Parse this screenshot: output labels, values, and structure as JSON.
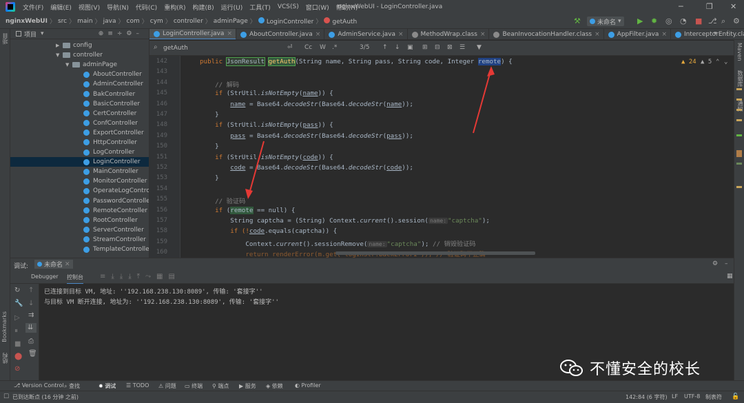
{
  "menu": {
    "items": [
      "文件(F)",
      "编辑(E)",
      "视图(V)",
      "导航(N)",
      "代码(C)",
      "重构(R)",
      "构建(B)",
      "运行(U)",
      "工具(T)",
      "VCS(S)",
      "窗口(W)",
      "帮助(H)"
    ],
    "window_title": "nginxWebUI - LoginController.java"
  },
  "breadcrumb": [
    "nginxWebUI",
    "src",
    "main",
    "java",
    "com",
    "cym",
    "controller",
    "adminPage",
    "LoginController",
    "getAuth"
  ],
  "toolbar": {
    "run_config": "未命名"
  },
  "project": {
    "header": "项目",
    "tree": [
      {
        "label": "config",
        "type": "folder",
        "indent": 1,
        "expanded": false
      },
      {
        "label": "controller",
        "type": "folder",
        "indent": 1,
        "expanded": true
      },
      {
        "label": "adminPage",
        "type": "folder",
        "indent": 2,
        "expanded": true
      },
      {
        "label": "AboutController",
        "type": "class",
        "indent": 3
      },
      {
        "label": "AdminController",
        "type": "class",
        "indent": 3
      },
      {
        "label": "BakController",
        "type": "class",
        "indent": 3
      },
      {
        "label": "BasicController",
        "type": "class",
        "indent": 3
      },
      {
        "label": "CertController",
        "type": "class",
        "indent": 3
      },
      {
        "label": "ConfController",
        "type": "class",
        "indent": 3
      },
      {
        "label": "ExportController",
        "type": "class",
        "indent": 3
      },
      {
        "label": "HttpController",
        "type": "class",
        "indent": 3
      },
      {
        "label": "LogController",
        "type": "class",
        "indent": 3
      },
      {
        "label": "LoginController",
        "type": "class",
        "indent": 3,
        "selected": true
      },
      {
        "label": "MainController",
        "type": "class",
        "indent": 3
      },
      {
        "label": "MonitorController",
        "type": "class",
        "indent": 3
      },
      {
        "label": "OperateLogControll",
        "type": "class",
        "indent": 3
      },
      {
        "label": "PasswordController",
        "type": "class",
        "indent": 3
      },
      {
        "label": "RemoteController",
        "type": "class",
        "indent": 3
      },
      {
        "label": "RootController",
        "type": "class",
        "indent": 3
      },
      {
        "label": "ServerController",
        "type": "class",
        "indent": 3
      },
      {
        "label": "StreamController",
        "type": "class",
        "indent": 3
      },
      {
        "label": "TemplateController",
        "type": "class",
        "indent": 3
      }
    ]
  },
  "tabs": [
    {
      "label": "LoginController.java",
      "active": true
    },
    {
      "label": "AboutController.java"
    },
    {
      "label": "AdminService.java"
    },
    {
      "label": "MethodWrap.class"
    },
    {
      "label": "BeanInvocationHandler.class"
    },
    {
      "label": "AppFilter.java"
    },
    {
      "label": "InterceptorEntity.cla"
    }
  ],
  "search": {
    "query": "getAuth",
    "count": "3/5",
    "cc": "Cc",
    "w": "W",
    "regex": ".*"
  },
  "inspections": {
    "warnings": "24",
    "weak_warnings": "5"
  },
  "editor": {
    "lines": [
      {
        "n": "142",
        "kind": "sig"
      },
      {
        "n": "143",
        "kind": "blank"
      },
      {
        "n": "144",
        "kind": "comment",
        "text": "// 解码"
      },
      {
        "n": "145",
        "kind": "if",
        "var": "name"
      },
      {
        "n": "146",
        "kind": "assign",
        "var": "name"
      },
      {
        "n": "147",
        "kind": "close"
      },
      {
        "n": "148",
        "kind": "if",
        "var": "pass"
      },
      {
        "n": "149",
        "kind": "assign",
        "var": "pass"
      },
      {
        "n": "150",
        "kind": "close"
      },
      {
        "n": "151",
        "kind": "if",
        "var": "code"
      },
      {
        "n": "152",
        "kind": "assign",
        "var": "code"
      },
      {
        "n": "153",
        "kind": "close"
      },
      {
        "n": "154",
        "kind": "blank"
      },
      {
        "n": "155",
        "kind": "comment",
        "text": "// 验证码"
      },
      {
        "n": "156",
        "kind": "ifremote"
      },
      {
        "n": "157",
        "kind": "captcha"
      },
      {
        "n": "158",
        "kind": "ifcode"
      },
      {
        "n": "159",
        "kind": "remove"
      },
      {
        "n": "160",
        "kind": "return"
      }
    ],
    "tokens": {
      "public": "public",
      "JsonResult": "JsonResult",
      "getAuth": "getAuth",
      "params": "(String name, String pass, String code, Integer ",
      "remote": "remote",
      "tail": ") {",
      "if": "if",
      "strutil": "(StrUtil.",
      "isNotEmpty": "isNotEmpty",
      "base64": " = Base64.",
      "decodeStr": "decodeStr",
      "remote_check": " == null) {",
      "captcha_decl": "String captcha = (String) Context.",
      "current": "current",
      "session": "().session(",
      "name_hint": "name:",
      "captcha_str": "\"captcha\"",
      "captcha_end": ");",
      "ifcode_a": "if (!",
      "ifcode_code": "code",
      "ifcode_b": ".equals(captcha)) {",
      "remove_a": "Context.",
      "remove_b": "().sessionRemove(",
      "remove_c": ");",
      "remove_comment": "// 销毁验证码",
      "return_line": "return renderError(m.get(\"loginStr.backError1\")); // 验证码不正确"
    }
  },
  "debug": {
    "title": "调试:",
    "config": "未命名",
    "tab_debugger": "Debugger",
    "tab_console": "控制台",
    "console": [
      "已连接到目标 VM, 地址: ''192.168.238.130:8089', 传输: '套接字''",
      "与目标 VM 断开连接, 地址为: ''192.168.238.130:8089', 传输: '套接字''"
    ]
  },
  "left_strip": {
    "project": "项目",
    "bookmarks": "Bookmarks",
    "structure": "结构"
  },
  "right_strip": {
    "maven": "Maven",
    "database": "数据库",
    "notifications": "通知"
  },
  "tool_tabs": [
    "Version Control",
    "查找",
    "调试",
    "TODO",
    "问题",
    "终端",
    "端点",
    "服务",
    "依赖",
    "Profiler"
  ],
  "status": {
    "message": "已连接到目标 VM, 地址: ''192.168.238.130:8089', 传输: '套接字''",
    "left": "已到达断点 (16 分钟 之前)",
    "position": "142:84 (6 字符)",
    "line_sep": "LF",
    "encoding": "UTF-8",
    "indent": "制表符"
  },
  "watermark": {
    "text": "不懂安全的校长"
  },
  "colors": {
    "accent": "#4a88c7",
    "arrow": "#e53935",
    "selection": "#214283"
  }
}
